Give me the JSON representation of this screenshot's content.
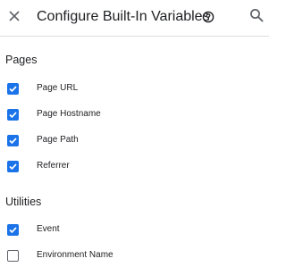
{
  "header": {
    "title": "Configure Built-In Variables",
    "icons": {
      "close": "close-icon",
      "help": "help-circle-icon",
      "search": "search-icon"
    }
  },
  "colors": {
    "accent": "#1a73e8",
    "divider": "#dadce0",
    "text": "#202124",
    "icon": "#5f6368"
  },
  "sections": [
    {
      "heading": "Pages",
      "items": [
        {
          "label": "Page URL",
          "checked": true
        },
        {
          "label": "Page Hostname",
          "checked": true
        },
        {
          "label": "Page Path",
          "checked": true
        },
        {
          "label": "Referrer",
          "checked": true
        }
      ]
    },
    {
      "heading": "Utilities",
      "items": [
        {
          "label": "Event",
          "checked": true
        },
        {
          "label": "Environment Name",
          "checked": false
        }
      ]
    }
  ]
}
